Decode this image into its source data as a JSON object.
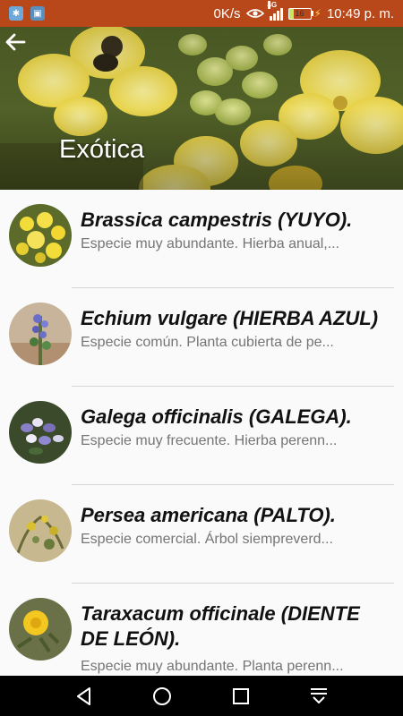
{
  "status_bar": {
    "net_speed": "0K/s",
    "network_type": "4G",
    "battery_level": "16",
    "time": "10:49 p. m.",
    "icons": [
      "bluetooth-app-icon",
      "gallery-app-icon",
      "eye-icon",
      "signal-icon",
      "battery-icon",
      "charging-icon"
    ]
  },
  "header": {
    "title": "Exótica",
    "back_icon": "arrow-left-icon"
  },
  "species": [
    {
      "title": "Brassica campestris (YUYO).",
      "description": "Especie muy abundante. Hierba anual,..."
    },
    {
      "title": "Echium vulgare (HIERBA AZUL)",
      "description": "Especie común. Planta cubierta de pe..."
    },
    {
      "title": "Galega officinalis (GALEGA).",
      "description": "Especie muy frecuente. Hierba perenn..."
    },
    {
      "title": "Persea americana (PALTO).",
      "description": "Especie comercial. Árbol siempreverd..."
    },
    {
      "title": "Taraxacum officinale (DIENTE DE LEÓN).",
      "description": "Especie muy abundante. Planta perenn..."
    }
  ],
  "nav_bar": {
    "icons": [
      "back-triangle-icon",
      "home-circle-icon",
      "recents-square-icon",
      "notifications-down-icon"
    ]
  },
  "colors": {
    "status_bar": "#b8471a",
    "list_background": "#fafafa",
    "title_text": "#111111",
    "description_text": "#757575"
  }
}
